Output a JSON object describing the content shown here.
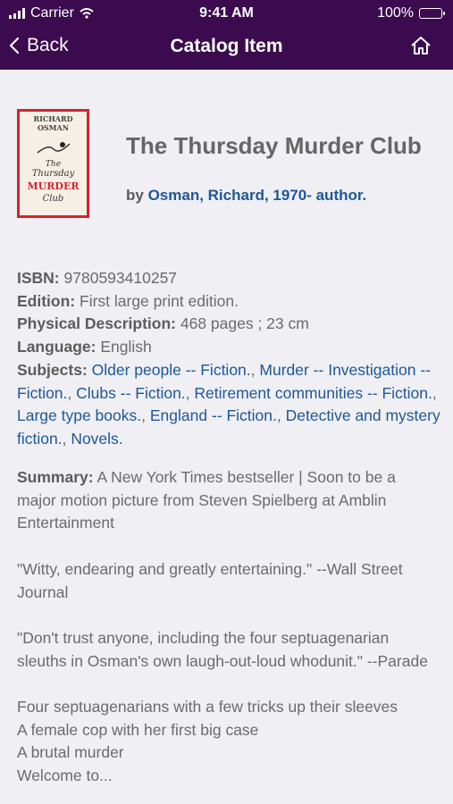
{
  "status_bar": {
    "carrier": "Carrier",
    "time": "9:41 AM",
    "battery": "100%"
  },
  "nav": {
    "back_label": "Back",
    "title": "Catalog Item"
  },
  "cover": {
    "author_line1": "RICHARD",
    "author_line2": "OSMAN",
    "title_word1": "The",
    "title_word2": "Thursday",
    "title_word3": "MURDER",
    "title_word4": "Club"
  },
  "book": {
    "title": "The Thursday Murder Club",
    "by_prefix": "by",
    "author": "Osman, Richard, 1970- author."
  },
  "details": {
    "isbn_label": "ISBN:",
    "isbn": "9780593410257",
    "edition_label": "Edition:",
    "edition": "First large print edition.",
    "physical_label": "Physical Description:",
    "physical": "468 pages ; 23 cm",
    "language_label": "Language:",
    "language": "English",
    "subjects_label": "Subjects:",
    "subjects": [
      "Older people -- Fiction.",
      "Murder -- Investigation -- Fiction.",
      "Clubs -- Fiction.",
      "Retirement communities -- Fiction.",
      "Large type books.",
      "England -- Fiction.",
      "Detective and mystery fiction.",
      "Novels."
    ]
  },
  "summary": {
    "label": "Summary:",
    "p1": "A New York Times bestseller | Soon to be a major motion picture from Steven Spielberg at Amblin Entertainment",
    "p2": "\"Witty, endearing and greatly entertaining.\" --Wall Street Journal",
    "p3": "\"Don't trust anyone, including the four septuagenarian sleuths in Osman's own laugh-out-loud whodunit.\" --Parade",
    "p4_lines": [
      "Four septuagenarians with a few tricks up their sleeves",
      "A female cop with her first big case",
      "A brutal murder",
      "Welcome to..."
    ]
  },
  "colors": {
    "header_bg": "#3c0a4f",
    "link": "#1f5796",
    "page_bg": "#efeff4",
    "cover_border": "#d4232b"
  }
}
